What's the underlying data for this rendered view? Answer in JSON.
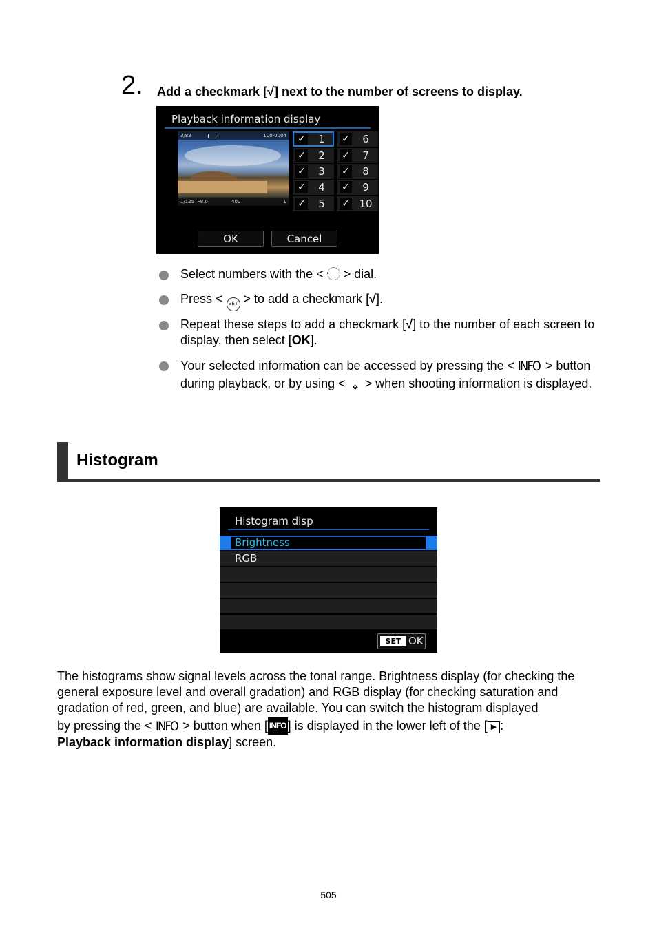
{
  "step": {
    "number": "2.",
    "text_before": "Add a checkmark [",
    "check_glyph": "√",
    "text_after": "] next to the number of screens to display."
  },
  "screen1": {
    "title": "Playback information display",
    "thumb": {
      "frame": "3/83",
      "file": "100-0004",
      "shutter": "1/125",
      "aperture": "F8.0",
      "iso": "400",
      "quality": "L"
    },
    "items": [
      {
        "num": "1",
        "checked": "✓",
        "selected": true
      },
      {
        "num": "2",
        "checked": "✓"
      },
      {
        "num": "3",
        "checked": "✓"
      },
      {
        "num": "4",
        "checked": "✓"
      },
      {
        "num": "5",
        "checked": "✓"
      },
      {
        "num": "6",
        "checked": "✓"
      },
      {
        "num": "7",
        "checked": "✓"
      },
      {
        "num": "8",
        "checked": "✓"
      },
      {
        "num": "9",
        "checked": "✓"
      },
      {
        "num": "10",
        "checked": "✓"
      }
    ],
    "ok_label": "OK",
    "cancel_label": "Cancel"
  },
  "bullets": [
    {
      "a": "Select numbers with the < ",
      "icon": "main-dial-icon",
      "b": " > dial."
    },
    {
      "a": "Press < ",
      "icon": "set-button-icon",
      "icon_text": "SET",
      "b": " > to add a checkmark [",
      "check": "√",
      "c": "]."
    },
    {
      "a": "Repeat these steps to add a checkmark [",
      "check": "√",
      "b": "] to the number of each screen to display, then select [",
      "bold": "OK",
      "c": "]."
    },
    {
      "a": "Your selected information can be accessed by pressing the < ",
      "icon_text": "INFO",
      "b": " > button during playback, or by using < ",
      "icon2": "multi-controller-icon",
      "c": " > when shooting information is displayed."
    }
  ],
  "section": {
    "title": "Histogram"
  },
  "screen2": {
    "title": "Histogram disp",
    "options": [
      "Brightness",
      "RGB"
    ],
    "selected": "Brightness",
    "set_label": "SET",
    "ok_label": "OK"
  },
  "paragraph": {
    "text1": "The histograms show signal levels across the tonal range. Brightness display (for checking the general exposure level and overall gradation) and RGB display (for checking saturation and gradation of red, green, and blue) are available. You can switch the histogram displayed",
    "text2a": "by pressing the < ",
    "info": "INFO",
    "text2b": " > button when [",
    "info_inv": "INFO",
    "text2c": "] is displayed in the lower left of the [",
    "play_icon": "▶",
    "text2d": ":",
    "bold": "Playback information display",
    "text3": "] screen."
  },
  "page_number": "505"
}
